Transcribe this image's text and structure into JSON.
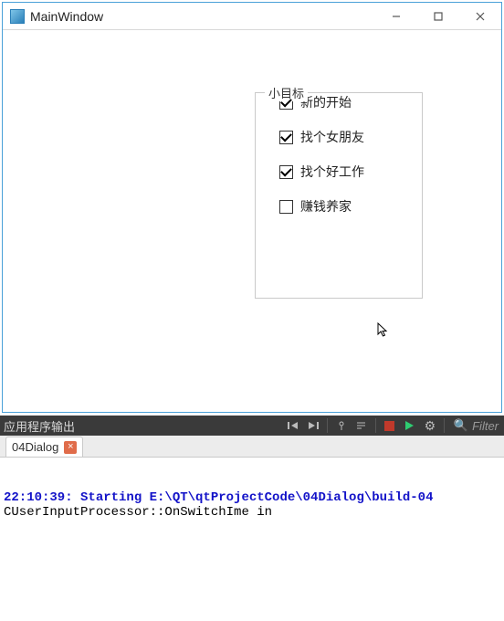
{
  "window": {
    "title": "MainWindow"
  },
  "groupbox": {
    "title": "小目标",
    "items": [
      {
        "label": "新的开始",
        "checked": true
      },
      {
        "label": "找个女朋友",
        "checked": true
      },
      {
        "label": "找个好工作",
        "checked": true
      },
      {
        "label": "赚钱养家",
        "checked": false
      }
    ]
  },
  "output_panel": {
    "header_label": "应用程序输出",
    "filter_placeholder": "Filter"
  },
  "tabs": [
    {
      "label": "04Dialog"
    }
  ],
  "console": {
    "line1": "22:10:39: Starting E:\\QT\\qtProjectCode\\04Dialog\\build-04",
    "line2": "CUserInputProcessor::OnSwitchIme in"
  }
}
